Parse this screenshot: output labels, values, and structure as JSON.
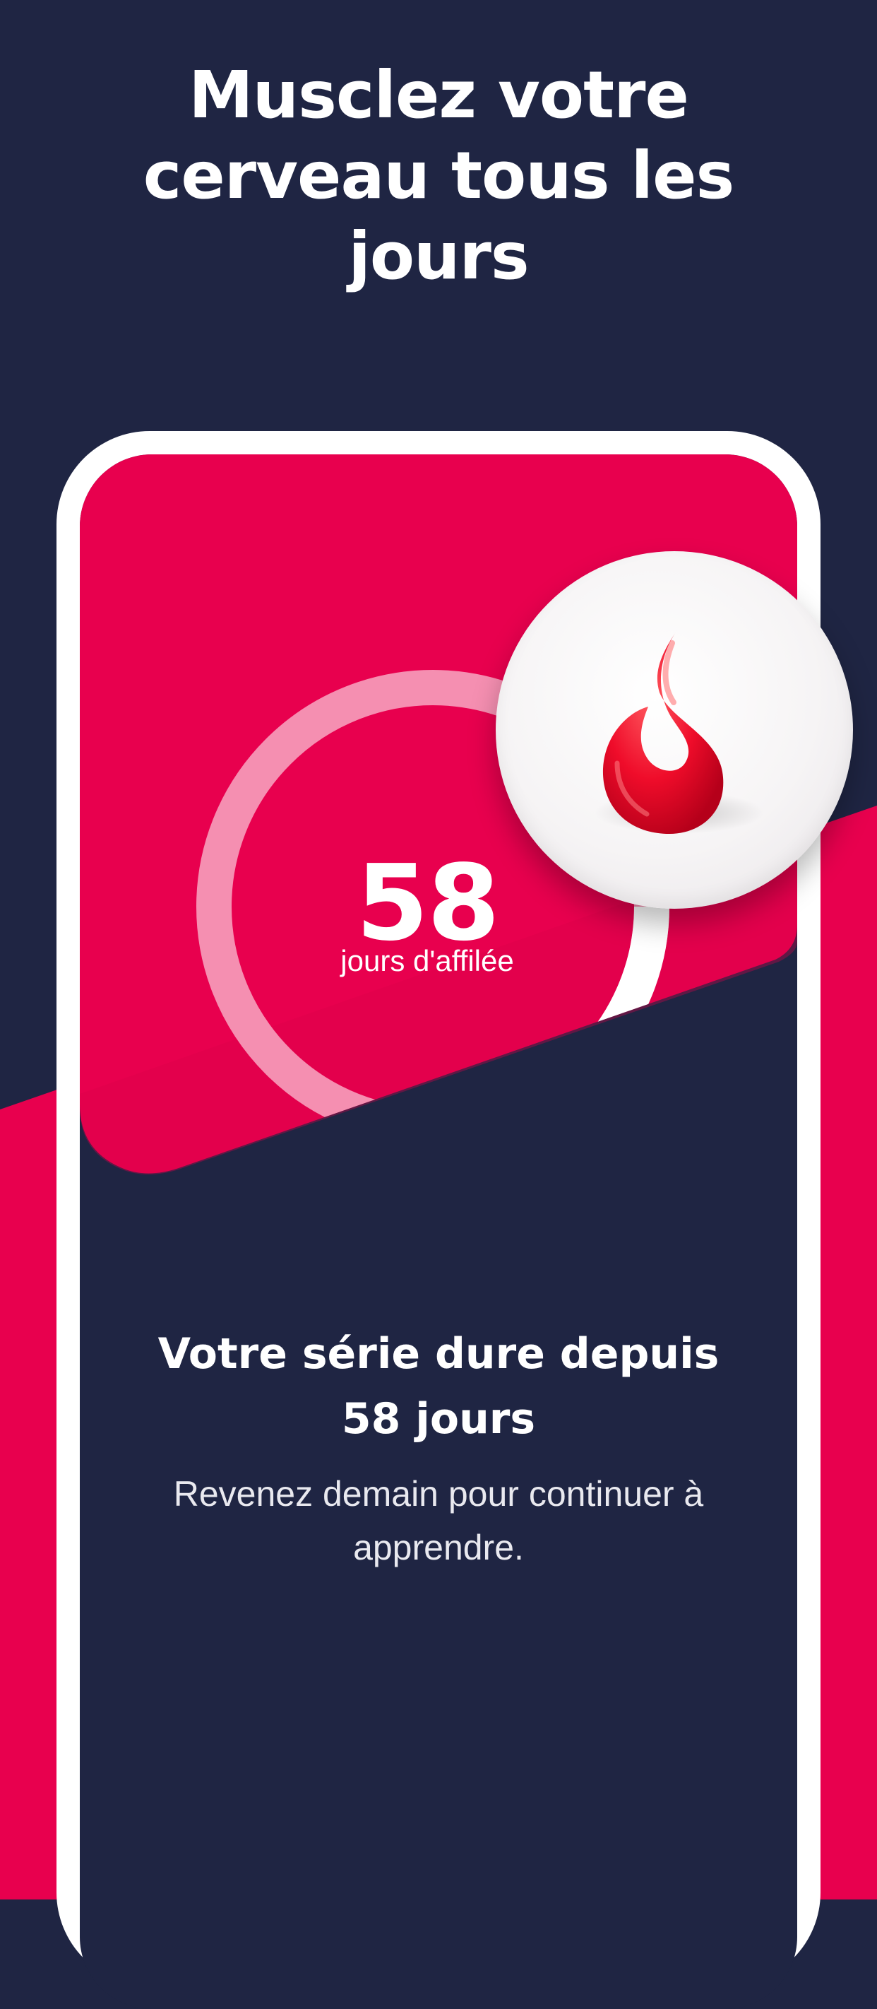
{
  "headline": {
    "line1": "Musclez votre",
    "line2": "cerveau tous les",
    "line3": "jours"
  },
  "streak": {
    "count": "58",
    "caption": "jours d'affilée",
    "progress_fraction": 0.44
  },
  "badge": {
    "icon": "flame-icon"
  },
  "message": {
    "title_line1": "Votre série dure depuis",
    "title_line2": "58 jours",
    "body_line1": "Revenez demain pour continuer à",
    "body_line2": "apprendre."
  },
  "colors": {
    "navy": "#1f2543",
    "accent": "#e8004e",
    "ring_track": "#f58fb1",
    "white": "#ffffff",
    "flame": "#ef0c2a"
  }
}
